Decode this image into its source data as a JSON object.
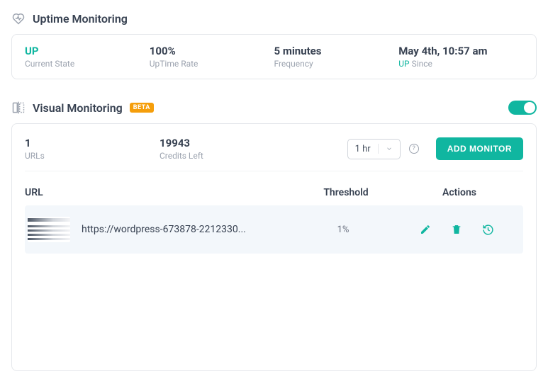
{
  "uptime": {
    "title": "Uptime Monitoring",
    "state": {
      "value": "UP",
      "label": "Current State"
    },
    "rate": {
      "value": "100%",
      "label": "UpTime Rate"
    },
    "frequency": {
      "value": "5 minutes",
      "label": "Frequency"
    },
    "since": {
      "value": "May 4th, 10:57 am",
      "prefix": "UP",
      "suffix": "Since"
    }
  },
  "visual": {
    "title": "Visual Monitoring",
    "badge": "BETA",
    "toggle_on": true,
    "urls_count": "1",
    "urls_label": "URLs",
    "credits_value": "19943",
    "credits_label": "Credits Left",
    "interval_selected": "1 hr",
    "add_button": "ADD MONITOR",
    "columns": {
      "url": "URL",
      "threshold": "Threshold",
      "actions": "Actions"
    },
    "rows": [
      {
        "url": "https://wordpress-673878-2212330...",
        "threshold": "1%"
      }
    ]
  }
}
